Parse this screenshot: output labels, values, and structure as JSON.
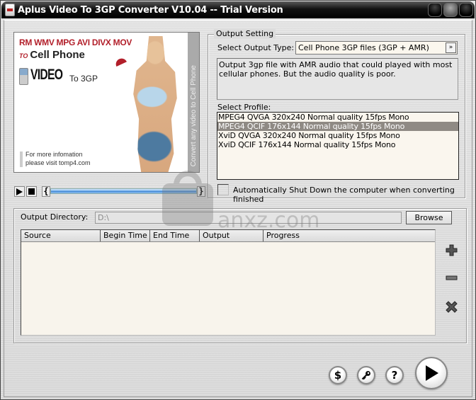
{
  "window": {
    "title": "Aplus Video To 3GP Converter V10.04 -- Trial Version"
  },
  "banner": {
    "formats": "RM WMV MPG AVI DIVX MOV",
    "to": "TO",
    "target": "Cell Phone",
    "video": "VIDEO",
    "to_3gp": "To 3GP",
    "info_line1": "For more infomation",
    "info_line2": "please visit tomp4.com",
    "side_text": "Convert any video to Cell Phone"
  },
  "player": {
    "play_icon": "play-icon",
    "stop_icon": "stop-icon",
    "start_marker": "{",
    "end_marker": "}"
  },
  "output_setting": {
    "group_title": "Output Setting",
    "output_type_label": "Select Output Type:",
    "output_type_value": "Cell Phone 3GP  files (3GP + AMR)",
    "dropdown_glyph": "»",
    "description": "Output 3gp file with AMR audio that could played with most cellular phones. But the audio quality is poor.",
    "profile_label": "Select Profile:",
    "profiles": [
      {
        "label": "MPEG4 QVGA 320x240 Normal quality 15fps Mono",
        "selected": false
      },
      {
        "label": "MPEG4 QCIF 176x144 Normal quality 15fps Mono",
        "selected": true
      },
      {
        "label": "XviD  QVGA 320x240 Normal quality 15fps Mono",
        "selected": false
      },
      {
        "label": "XviD  QCIF 176x144 Normal quality 15fps Mono",
        "selected": false
      }
    ],
    "shutdown_label": "Automatically Shut Down the computer when converting finished",
    "shutdown_checked": false
  },
  "output_directory": {
    "label": "Output Directory:",
    "value": "D:\\",
    "browse_label": "Browse"
  },
  "file_table": {
    "columns": [
      "Source",
      "Begin Time",
      "End Time",
      "Output",
      "Progress"
    ],
    "rows": []
  },
  "side_actions": {
    "add": "add-icon",
    "remove": "remove-icon",
    "clear": "clear-icon"
  },
  "bottom_actions": {
    "buy_glyph": "$",
    "register": "key-icon",
    "help_glyph": "?",
    "start": "play-icon"
  },
  "watermark": {
    "text": "anxz.com"
  }
}
